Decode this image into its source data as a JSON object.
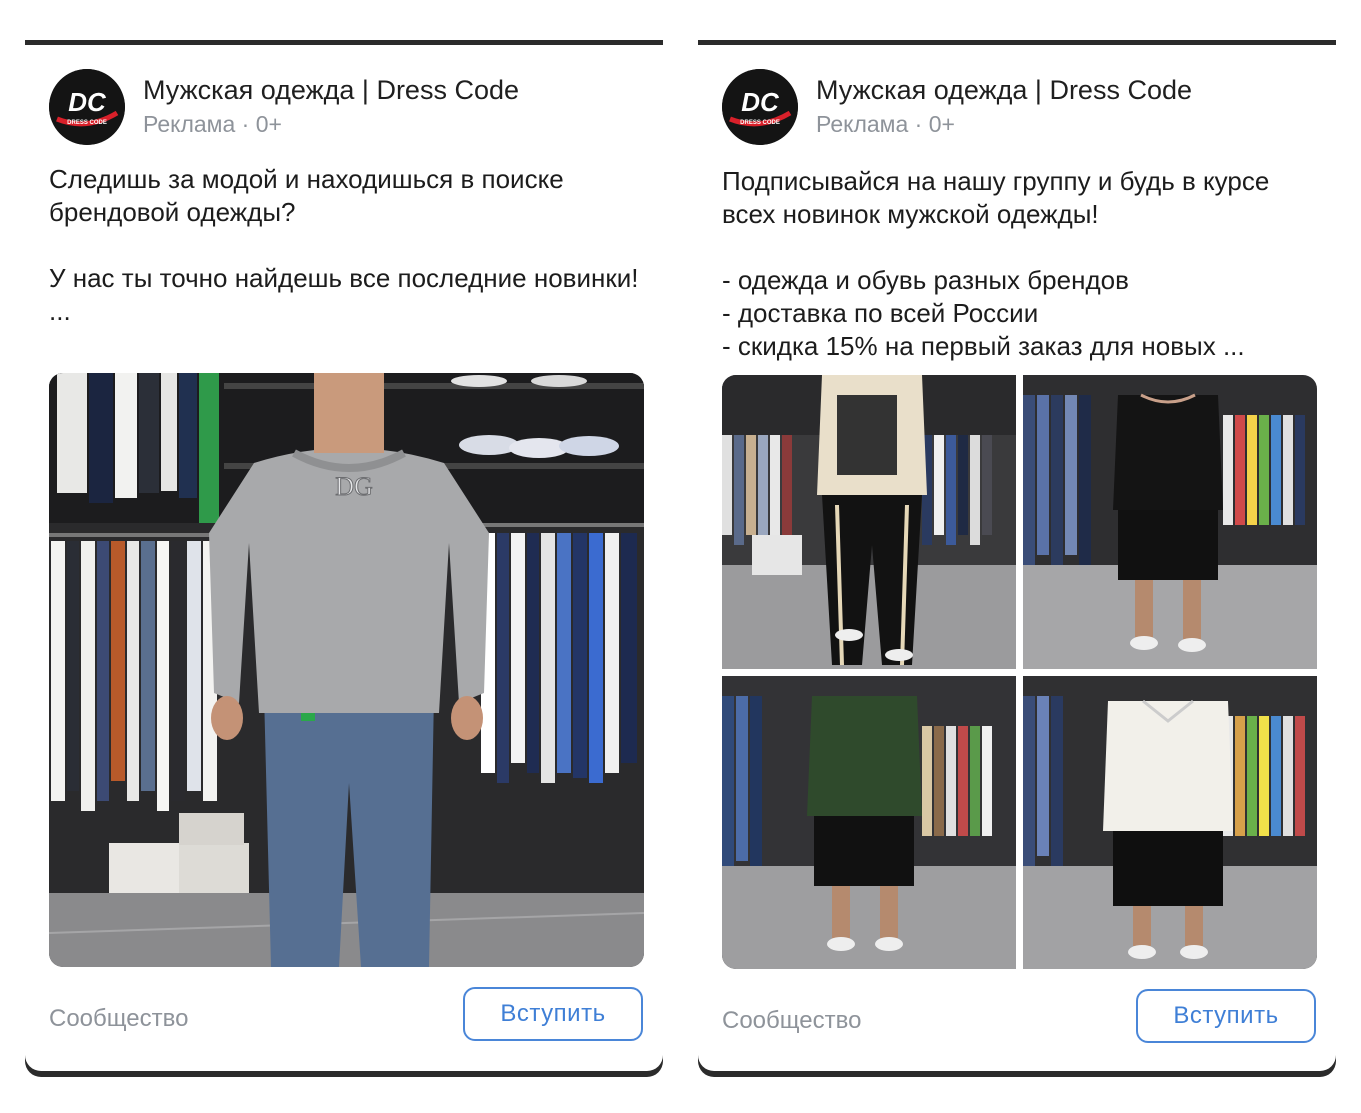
{
  "cards": [
    {
      "brand_name": "Мужская одежда | Dress Code",
      "meta": "Реклама · 0+",
      "avatar_logo_text": "DC",
      "avatar_logo_subtext": "DRESS CODE",
      "text": "Следишь за модой и находишься в поиске брендовой одежды?\n\nУ нас ты точно найдешь все последние новинки!\n...",
      "footer_label": "Сообщество",
      "join_label": "Вступить",
      "image_logo_text": "DG"
    },
    {
      "brand_name": "Мужская одежда | Dress Code",
      "meta": "Реклама · 0+",
      "avatar_logo_text": "DC",
      "avatar_logo_subtext": "DRESS CODE",
      "text": "Подписывайся на нашу группу и будь в курсе всех новинок мужской одежды!\n\n- одежда и обувь разных брендов\n- доставка по всей России\n- скидка 15% на первый заказ для новых ...",
      "footer_label": "Сообщество",
      "join_label": "Вступить"
    }
  ],
  "colors": {
    "accent": "#3f7fd6",
    "muted": "#8e939a",
    "text": "#1c1c1c"
  }
}
